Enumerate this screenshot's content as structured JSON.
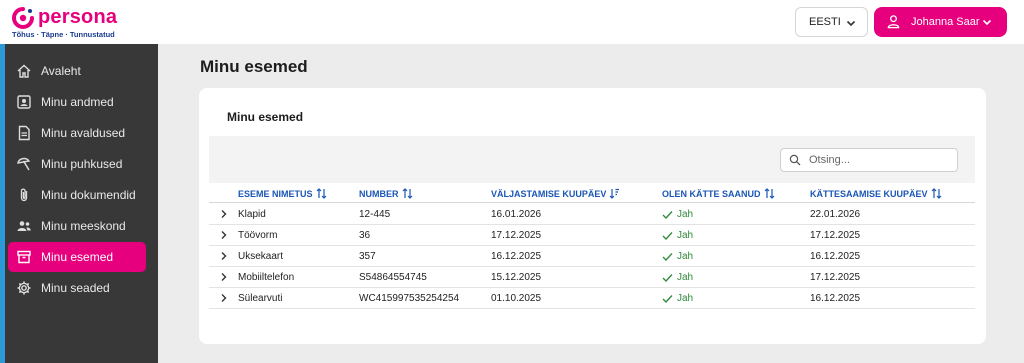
{
  "brand": {
    "name": "persona",
    "tagline": "Tõhus · Täpne · Tunnustatud",
    "color": "#e6007e"
  },
  "header": {
    "language": "EESTI",
    "user_name": "Johanna Saar"
  },
  "sidebar": {
    "items": [
      {
        "label": "Avaleht",
        "icon": "home-icon"
      },
      {
        "label": "Minu andmed",
        "icon": "id-card-icon"
      },
      {
        "label": "Minu avaldused",
        "icon": "document-icon"
      },
      {
        "label": "Minu puhkused",
        "icon": "beach-umbrella-icon"
      },
      {
        "label": "Minu dokumendid",
        "icon": "paperclip-icon"
      },
      {
        "label": "Minu meeskond",
        "icon": "team-icon"
      },
      {
        "label": "Minu esemed",
        "icon": "archive-box-icon",
        "active": true
      },
      {
        "label": "Minu seaded",
        "icon": "gear-icon"
      }
    ]
  },
  "main": {
    "title": "Minu esemed",
    "card_title": "Minu esemed",
    "search_placeholder": "Otsing...",
    "columns": [
      "ESEME NIMETUS",
      "NUMBER",
      "VÄLJASTAMISE KUUPÄEV",
      "OLEN KÄTTE SAANUD",
      "KÄTTESAAMISE KUUPÄEV"
    ],
    "rows": [
      {
        "name": "Klapid",
        "number": "12-445",
        "issued": "16.01.2026",
        "received": "Jah",
        "received_date": "22.01.2026"
      },
      {
        "name": "Töövorm",
        "number": "36",
        "issued": "17.12.2025",
        "received": "Jah",
        "received_date": "17.12.2025"
      },
      {
        "name": "Uksekaart",
        "number": "357",
        "issued": "16.12.2025",
        "received": "Jah",
        "received_date": "16.12.2025"
      },
      {
        "name": "Mobiiltelefon",
        "number": "S54864554745",
        "issued": "15.12.2025",
        "received": "Jah",
        "received_date": "17.12.2025"
      },
      {
        "name": "Sülearvuti",
        "number": "WC415997535254254",
        "issued": "01.10.2025",
        "received": "Jah",
        "received_date": "16.12.2025"
      }
    ]
  }
}
